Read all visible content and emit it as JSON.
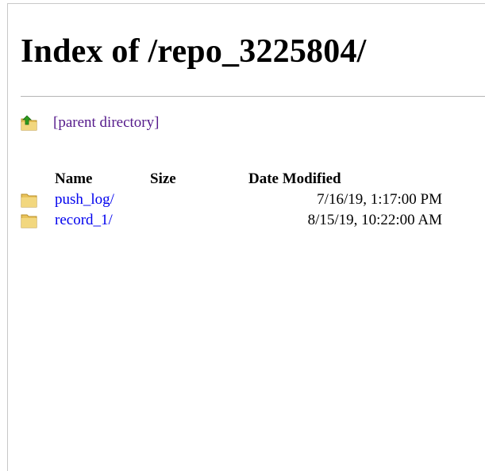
{
  "page": {
    "title": "Index of /repo_3225804/"
  },
  "parent_link": {
    "label": "[parent directory]"
  },
  "table": {
    "headers": {
      "name": "Name",
      "size": "Size",
      "date": "Date Modified"
    },
    "rows": [
      {
        "name": "push_log/",
        "size": "",
        "date": "7/16/19, 1:17:00 PM",
        "icon": "folder-icon"
      },
      {
        "name": "record_1/",
        "size": "",
        "date": "8/15/19, 10:22:00 AM",
        "icon": "folder-icon"
      }
    ]
  },
  "colors": {
    "link": "#0000ee",
    "visited_link": "#551a8b",
    "folder": "#e8c25a",
    "up_arrow": "#2e9c1e"
  }
}
